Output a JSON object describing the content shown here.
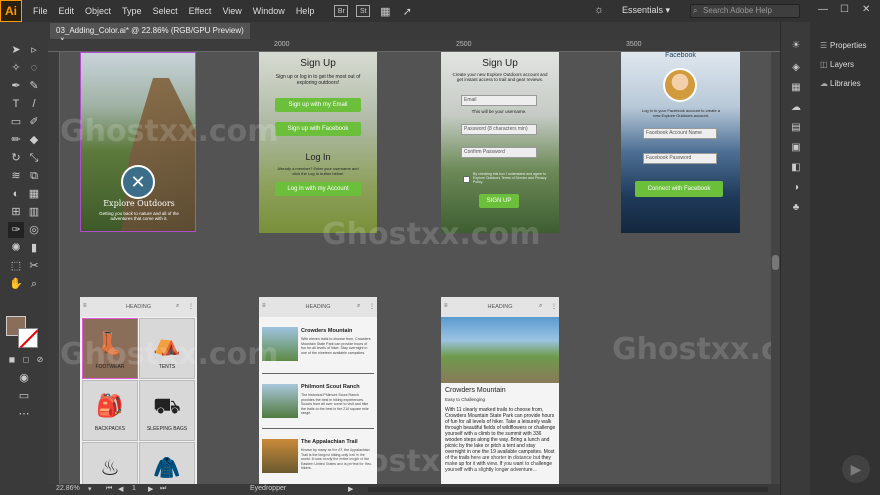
{
  "menubar": {
    "logo": "Ai",
    "items": [
      "File",
      "Edit",
      "Object",
      "Type",
      "Select",
      "Effect",
      "View",
      "Window",
      "Help"
    ],
    "badges": [
      "Br",
      "St"
    ],
    "workspace": "Essentials",
    "search_placeholder": "Search Adobe Help"
  },
  "document": {
    "tab": "03_Adding_Color.ai* @ 22.86% (RGB/GPU Preview)",
    "close": "×"
  },
  "ruler": {
    "top": [
      "2000",
      "2500",
      "3000",
      "3500"
    ]
  },
  "panels": {
    "properties": "Properties",
    "layers": "Layers",
    "libraries": "Libraries"
  },
  "status": {
    "zoom": "22.86%",
    "page": "1",
    "tool": "Eyedropper"
  },
  "watermark": "Ghostxx.com",
  "artboards": {
    "explore": {
      "title": "Explore Outdoors",
      "tagline": "Getting you back to nature and all of the adventures that come with it."
    },
    "signup1": {
      "title": "Sign Up",
      "intro": "Sign up or log in to get the most out of exploring outdoors!",
      "btn_email": "Sign up with my Email",
      "btn_facebook": "Sign up with Facebook",
      "login_title": "Log In",
      "login_text": "Already a member? Enter your username and click the Log In button below.",
      "btn_login": "Log in with my Account"
    },
    "signup2": {
      "title": "Sign Up",
      "intro": "Create your new Explore Outdoors account and get instant access to trail and gear reviews.",
      "email": "Email",
      "username_note": "This will be your username.",
      "password": "Password (8 characters min)",
      "confirm": "Confirm Password",
      "agree": "By checking this box I understand and agree to Explore Outdoors Terms of Service and Privacy Policy.",
      "btn": "SIGN UP"
    },
    "facebook": {
      "title": "Facebook",
      "intro": "Log in to your Facebook account to create a new Explore Outdoors account.",
      "fb_name": "Facebook Account Name",
      "fb_pass": "Facebook Password",
      "btn": "Connect with Facebook"
    },
    "gear": {
      "heading": "HEADING",
      "items": [
        "FOOTWEAR",
        "TENTS",
        "BACKPACKS",
        "SLEEPING BAGS",
        "",
        ""
      ]
    },
    "trails": {
      "heading": "HEADING",
      "items": [
        {
          "title": "Crowders Mountain",
          "text": "With eleven trails to choose from, Crowders Mountain State Park can provide hours of fun for all levels of hiker. Stay overnight in one of the nineteen available campsites."
        },
        {
          "title": "Philmont Scout Ranch",
          "text": "The historical Philmont Scout Ranch provides the best in hiking experiences. Scouts from all over come to visit and hike the trails to the best in the 214 square mile range."
        },
        {
          "title": "The Appalachian Trail",
          "text": "Known by many as the AT, the Appalachian Trail is the longest hiking-only trail in the world. It runs nearly the entire length of the Eastern United States and is perfect for thru-hikers."
        }
      ]
    },
    "detail": {
      "heading": "HEADING",
      "title": "Crowders Mountain",
      "difficulty": "Easy to Challenging",
      "body": "With 11 clearly marked trails to choose from, Crowders Mountain State Park can provide hours of fun for all levels of hiker. Take a leisurely walk through beautiful fields of wildflowers or challenge yourself with a climb to the summit with 336 wooden steps along the way. Bring a lunch and picnic by the lake or pitch a tent and stay overnight in one the 19 available campsites. Most of the trails here are shorter in distance but they make up for it with view. If you want to challenge yourself with a slightly longer adventure..."
    }
  },
  "colors": {
    "accent_green": "#6cbf3a",
    "selection": "#b14dcc",
    "ui_dark": "#323232"
  }
}
